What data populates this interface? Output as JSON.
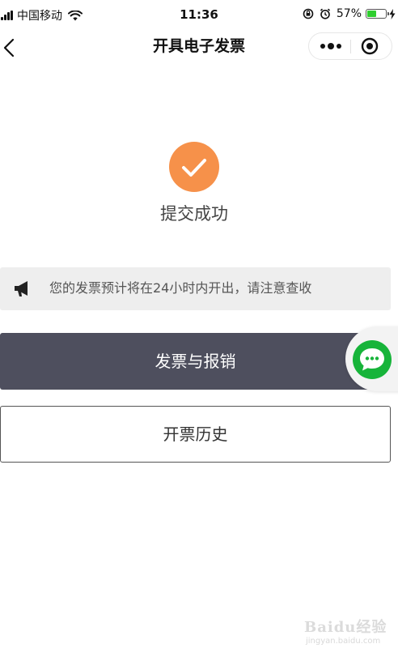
{
  "status_bar": {
    "carrier": "中国移动",
    "time": "11:36",
    "battery_percent": "57%",
    "battery_level": 0.57,
    "battery_color": "#2fce2f"
  },
  "nav": {
    "title": "开具电子发票",
    "back_icon": "chevron-left-icon",
    "more_icon": "more-dots-icon",
    "close_icon": "target-circle-icon"
  },
  "result": {
    "icon": "check-circle-icon",
    "icon_color": "#f6914a",
    "message": "提交成功"
  },
  "notice": {
    "icon": "megaphone-icon",
    "text": "您的发票预计将在24小时内开出，请注意查收"
  },
  "actions": {
    "primary_label": "发票与报销",
    "primary_color": "#4e4f5e",
    "secondary_label": "开票历史"
  },
  "chat": {
    "icon": "chat-bubble-icon",
    "color": "#17b43a"
  },
  "watermark": {
    "brand": "Baidu经验",
    "url": "jingyan.baidu.com"
  }
}
